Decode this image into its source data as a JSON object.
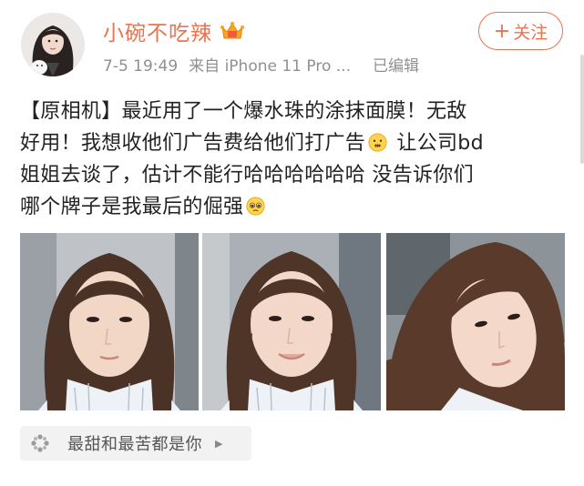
{
  "user": {
    "name": "小碗不吃辣",
    "avatar_icon": "avatar-photo-icon",
    "badge_icon": "vip-crown-icon"
  },
  "meta": {
    "time": "7-5 19:49",
    "source": "来自 iPhone 11 Pro ...",
    "edited": "已编辑"
  },
  "follow": {
    "plus": "+",
    "label": "关注"
  },
  "post": {
    "line1": "【原相机】最近用了一个爆水珠的涂抹面膜！无敌",
    "line2a": "好用！我想收他们广告费给他们打广告",
    "line2b": " 让公司bd",
    "line3": "姐姐去谈了，估计不能行哈哈哈哈哈哈 没告诉你们",
    "line4": "哪个牌子是我最后的倔强",
    "emoji1": "secret-emoji-icon",
    "emoji2": "pleading-emoji-icon"
  },
  "photos": [
    {
      "icon": "selfie-photo-icon"
    },
    {
      "icon": "selfie-photo-icon"
    },
    {
      "icon": "selfie-photo-icon"
    }
  ],
  "topic": {
    "label": "最甜和最苦都是你",
    "icon": "super-topic-icon",
    "arrow": "▶"
  },
  "colors": {
    "accent": "#eb7350",
    "text": "#222222",
    "meta": "#909090",
    "pill_bg": "#f2f2f2"
  }
}
